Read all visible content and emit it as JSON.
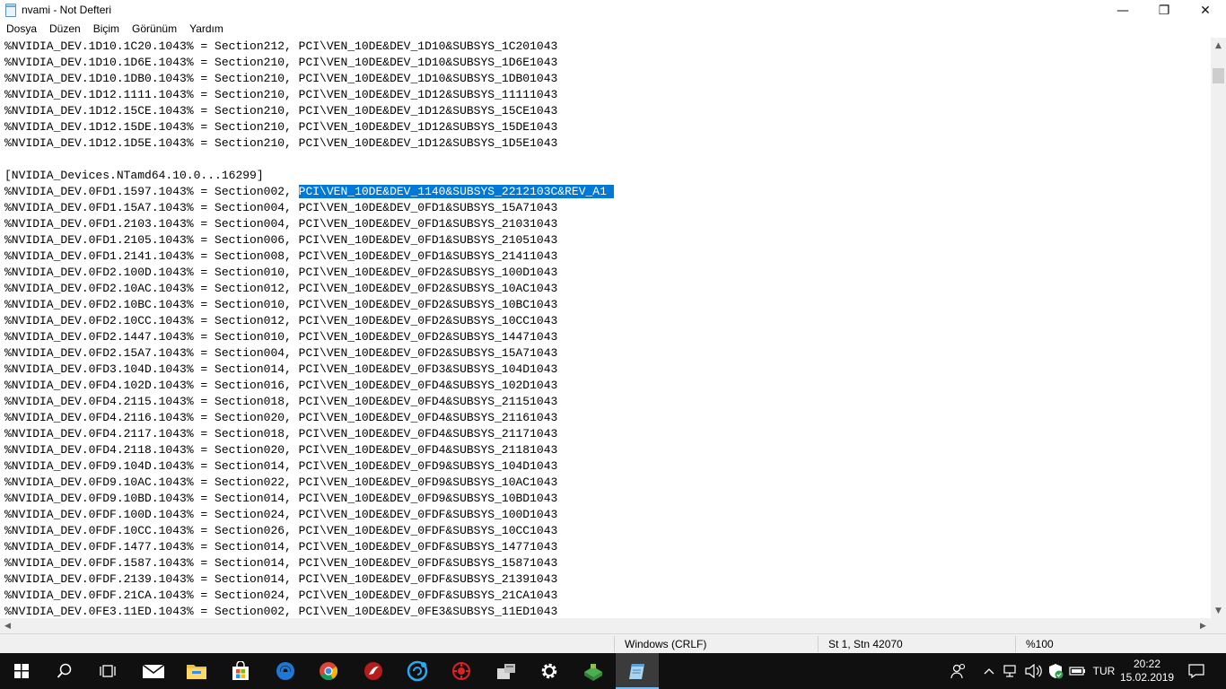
{
  "window": {
    "title": "nvami - Not Defteri",
    "controls": {
      "minimize": "—",
      "maximize": "❐",
      "close": "✕"
    }
  },
  "menu": [
    "Dosya",
    "Düzen",
    "Biçim",
    "Görünüm",
    "Yardım"
  ],
  "editor": {
    "lines_before": [
      "%NVIDIA_DEV.1D10.1C20.1043% = Section212, PCI\\VEN_10DE&DEV_1D10&SUBSYS_1C201043",
      "%NVIDIA_DEV.1D10.1D6E.1043% = Section210, PCI\\VEN_10DE&DEV_1D10&SUBSYS_1D6E1043",
      "%NVIDIA_DEV.1D10.1DB0.1043% = Section210, PCI\\VEN_10DE&DEV_1D10&SUBSYS_1DB01043",
      "%NVIDIA_DEV.1D12.1111.1043% = Section210, PCI\\VEN_10DE&DEV_1D12&SUBSYS_11111043",
      "%NVIDIA_DEV.1D12.15CE.1043% = Section210, PCI\\VEN_10DE&DEV_1D12&SUBSYS_15CE1043",
      "%NVIDIA_DEV.1D12.15DE.1043% = Section210, PCI\\VEN_10DE&DEV_1D12&SUBSYS_15DE1043",
      "%NVIDIA_DEV.1D12.1D5E.1043% = Section210, PCI\\VEN_10DE&DEV_1D12&SUBSYS_1D5E1043",
      "",
      "[NVIDIA_Devices.NTamd64.10.0...16299]"
    ],
    "selected_line_prefix": "%NVIDIA_DEV.0FD1.1597.1043% = Section002, ",
    "selected_text": "PCI\\VEN_10DE&DEV_1140&SUBSYS_2212103C&REV_A1 ",
    "lines_after": [
      "%NVIDIA_DEV.0FD1.15A7.1043% = Section004, PCI\\VEN_10DE&DEV_0FD1&SUBSYS_15A71043",
      "%NVIDIA_DEV.0FD1.2103.1043% = Section004, PCI\\VEN_10DE&DEV_0FD1&SUBSYS_21031043",
      "%NVIDIA_DEV.0FD1.2105.1043% = Section006, PCI\\VEN_10DE&DEV_0FD1&SUBSYS_21051043",
      "%NVIDIA_DEV.0FD1.2141.1043% = Section008, PCI\\VEN_10DE&DEV_0FD1&SUBSYS_21411043",
      "%NVIDIA_DEV.0FD2.100D.1043% = Section010, PCI\\VEN_10DE&DEV_0FD2&SUBSYS_100D1043",
      "%NVIDIA_DEV.0FD2.10AC.1043% = Section012, PCI\\VEN_10DE&DEV_0FD2&SUBSYS_10AC1043",
      "%NVIDIA_DEV.0FD2.10BC.1043% = Section010, PCI\\VEN_10DE&DEV_0FD2&SUBSYS_10BC1043",
      "%NVIDIA_DEV.0FD2.10CC.1043% = Section012, PCI\\VEN_10DE&DEV_0FD2&SUBSYS_10CC1043",
      "%NVIDIA_DEV.0FD2.1447.1043% = Section010, PCI\\VEN_10DE&DEV_0FD2&SUBSYS_14471043",
      "%NVIDIA_DEV.0FD2.15A7.1043% = Section004, PCI\\VEN_10DE&DEV_0FD2&SUBSYS_15A71043",
      "%NVIDIA_DEV.0FD3.104D.1043% = Section014, PCI\\VEN_10DE&DEV_0FD3&SUBSYS_104D1043",
      "%NVIDIA_DEV.0FD4.102D.1043% = Section016, PCI\\VEN_10DE&DEV_0FD4&SUBSYS_102D1043",
      "%NVIDIA_DEV.0FD4.2115.1043% = Section018, PCI\\VEN_10DE&DEV_0FD4&SUBSYS_21151043",
      "%NVIDIA_DEV.0FD4.2116.1043% = Section020, PCI\\VEN_10DE&DEV_0FD4&SUBSYS_21161043",
      "%NVIDIA_DEV.0FD4.2117.1043% = Section018, PCI\\VEN_10DE&DEV_0FD4&SUBSYS_21171043",
      "%NVIDIA_DEV.0FD4.2118.1043% = Section020, PCI\\VEN_10DE&DEV_0FD4&SUBSYS_21181043",
      "%NVIDIA_DEV.0FD9.104D.1043% = Section014, PCI\\VEN_10DE&DEV_0FD9&SUBSYS_104D1043",
      "%NVIDIA_DEV.0FD9.10AC.1043% = Section022, PCI\\VEN_10DE&DEV_0FD9&SUBSYS_10AC1043",
      "%NVIDIA_DEV.0FD9.10BD.1043% = Section014, PCI\\VEN_10DE&DEV_0FD9&SUBSYS_10BD1043",
      "%NVIDIA_DEV.0FDF.100D.1043% = Section024, PCI\\VEN_10DE&DEV_0FDF&SUBSYS_100D1043",
      "%NVIDIA_DEV.0FDF.10CC.1043% = Section026, PCI\\VEN_10DE&DEV_0FDF&SUBSYS_10CC1043",
      "%NVIDIA_DEV.0FDF.1477.1043% = Section014, PCI\\VEN_10DE&DEV_0FDF&SUBSYS_14771043",
      "%NVIDIA_DEV.0FDF.1587.1043% = Section014, PCI\\VEN_10DE&DEV_0FDF&SUBSYS_15871043",
      "%NVIDIA_DEV.0FDF.2139.1043% = Section014, PCI\\VEN_10DE&DEV_0FDF&SUBSYS_21391043",
      "%NVIDIA_DEV.0FDF.21CA.1043% = Section024, PCI\\VEN_10DE&DEV_0FDF&SUBSYS_21CA1043",
      "%NVIDIA_DEV.0FE3.11ED.1043% = Section002, PCI\\VEN_10DE&DEV_0FE3&SUBSYS_11ED1043"
    ]
  },
  "statusbar": {
    "line_ending": "Windows (CRLF)",
    "position": "St 1, Stn 42070",
    "zoom": "%100"
  },
  "taskbar": {
    "apps": [
      {
        "name": "start-icon"
      },
      {
        "name": "search-icon"
      },
      {
        "name": "task-view-icon"
      },
      {
        "name": "mail-icon"
      },
      {
        "name": "file-explorer-icon"
      },
      {
        "name": "store-icon"
      },
      {
        "name": "edge-icon"
      },
      {
        "name": "chrome-icon"
      },
      {
        "name": "game-app-icon"
      },
      {
        "name": "refresh-app-icon"
      },
      {
        "name": "red-circle-app-icon"
      },
      {
        "name": "driver-tool-icon"
      },
      {
        "name": "settings-icon"
      },
      {
        "name": "green-box-icon"
      },
      {
        "name": "notepad-icon"
      }
    ],
    "language": "TUR",
    "time": "20:22",
    "date": "15.02.2019"
  },
  "colors": {
    "selection": "#0078d7",
    "taskbar": "#101010",
    "active_indicator": "#76b9ed"
  }
}
